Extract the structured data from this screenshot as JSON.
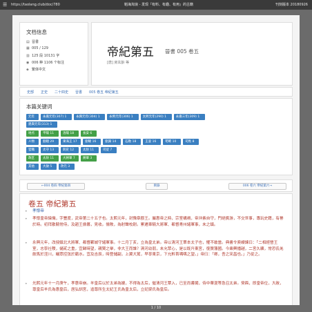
{
  "viewer": {
    "menu_icon": "menu-icon",
    "url": "https://taolang.club/doc/780",
    "title": "韜海淘浪 - 发现『有料、有趣、有用』的古籍",
    "meta": "刊刻版本 20180926",
    "pager": "1 / 10"
  },
  "doc_info": {
    "heading": "文档信息",
    "rows": [
      {
        "icon": "book-icon",
        "text": "晉書"
      },
      {
        "icon": "pages-icon",
        "text": "005 / 129"
      },
      {
        "icon": "size-icon",
        "text": "125 段 10131 字"
      },
      {
        "icon": "views-icon",
        "text": "006 种 1106 个标注"
      },
      {
        "icon": "lang-icon",
        "text": "繁体中文"
      }
    ]
  },
  "title": {
    "main": "帝紀第五",
    "sub": "晉書 005 卷五",
    "author": "[唐] 房玄齡 等"
  },
  "breadcrumbs": [
    "史部",
    "正史",
    "二十四史",
    "晉書",
    "005 卷五 帝紀第五"
  ],
  "keywords": {
    "heading": "本篇关键词",
    "rows": [
      [
        {
          "text": "元年",
          "color": "blue"
        },
        {
          "text": "永嘉元年(307) 1",
          "color": "blue"
        },
        {
          "text": "永興元年(304) 1",
          "color": "blue"
        },
        {
          "text": "永熙元年(306) 1",
          "color": "blue"
        },
        {
          "text": "太熙元年(290) 1",
          "color": "blue"
        },
        {
          "text": "永嘉三年(309) 1",
          "color": "blue"
        }
      ],
      [
        {
          "text": "建興元年(313) 1",
          "color": "blue"
        }
      ],
      [
        {
          "text": "地点",
          "color": "green"
        },
        {
          "text": "平陽 11",
          "color": "green"
        },
        {
          "text": "洛陽 18",
          "color": "green"
        },
        {
          "text": "長安 6",
          "color": "green"
        }
      ],
      [
        {
          "text": "人物",
          "color": "blue"
        },
        {
          "text": "劉聰 29",
          "color": "blue"
        },
        {
          "text": "東海王 17",
          "color": "blue"
        },
        {
          "text": "劉曜 16",
          "color": "blue"
        },
        {
          "text": "劉淵 14",
          "color": "blue"
        },
        {
          "text": "石勒 18",
          "color": "blue"
        },
        {
          "text": "王浚 16",
          "color": "blue"
        },
        {
          "text": "苟晞 10",
          "color": "blue"
        },
        {
          "text": "司馬 8",
          "color": "blue"
        }
      ],
      [
        {
          "text": "官職",
          "color": "blue"
        },
        {
          "text": "太守 13",
          "color": "blue"
        },
        {
          "text": "刺史 12",
          "color": "blue"
        },
        {
          "text": "太尉 11",
          "color": "blue"
        },
        {
          "text": "司徒 7",
          "color": "blue"
        }
      ],
      [
        {
          "text": "政区",
          "color": "green"
        },
        {
          "text": "太尉 11",
          "color": "green"
        },
        {
          "text": "大將軍 7",
          "color": "green"
        },
        {
          "text": "將軍 3",
          "color": "green"
        }
      ],
      [
        {
          "text": "其他",
          "color": "blue"
        },
        {
          "text": "大赦 5",
          "color": "blue"
        },
        {
          "text": "改元 3",
          "color": "blue"
        }
      ]
    ]
  },
  "nav": {
    "prev": "←004 卷四 帝紀第四",
    "toc": "目錄",
    "next": "006 卷六 帝紀第六→"
  },
  "text": {
    "chapter": "卷五 帝紀第五",
    "p1_title": "孝懷帝",
    "p1": "孝懷皇帝諱熾，字豐度，武帝第二十五子也。太熙元年，封豫章郡王。屬惠帝之時，宗室構禍，帝沖素自守，門絕賓游，不交世事，專玩史籍，有譽於時。初拜散騎常侍，及趙王倫篡，見收。倫敗，為射聲校尉。累遷車騎大將軍、都督青州諸軍事，未之鎮。",
    "p2": "永興元年，改授鎮北大將軍、都督鄴城守諸軍事。十二月丁亥，立為皇太弟。帝以清河王覃本太子也，懼不敢當。典書令庾嶸諫曰：「二相經營王室，志寧社稷，儲貳之重，宜歸時望，親賢之舉，非大王而誰？清河幼弱，未允眾心，是以既升東宮，復贊藩國。今乘輿播越，二宮久曠，常恐氐羌飲馬於涇川，蟻眾控弦於霸水。宜及吉辰，時登儲副，上翼大駕，早寧東京，下允黔首喁喁之望。」帝曰：「卿，吾之宋昌也。」乃從之。",
    "p3": "光熙元年十一月庚午，孝惠帝崩。羊皇后以於太弟為嫂，不得為太后，催清河王覃入，已至尚書閣，侍中華混等急召太弟。癸酉，即皇帝位，大赦，尊皇后羊氏為惠皇后，居弘訓宮，追尊所生太妃王氏為皇太后，立妃梁氏為皇后。"
  }
}
